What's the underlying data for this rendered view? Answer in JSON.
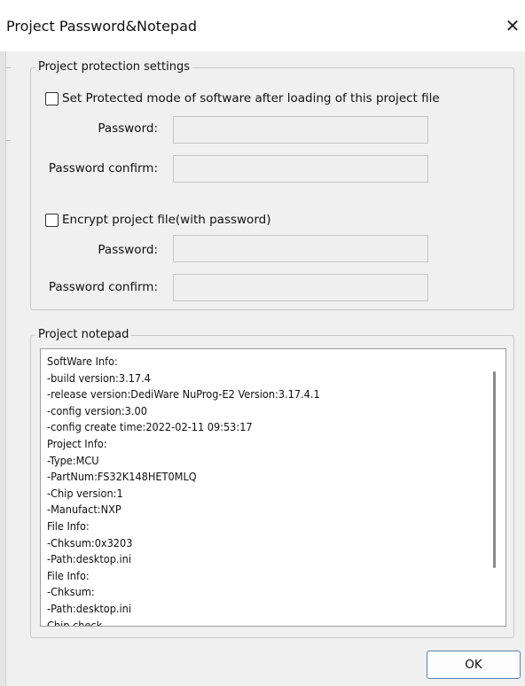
{
  "window": {
    "title": "Project Password&Notepad",
    "close_icon": "close-icon"
  },
  "protection": {
    "legend": "Project protection settings",
    "protected_mode": {
      "label": "Set Protected mode of software after loading of this project file",
      "checked": false,
      "password_label": "Password:",
      "password_value": "",
      "confirm_label": "Password confirm:",
      "confirm_value": ""
    },
    "encrypt": {
      "label": "Encrypt project file(with password)",
      "checked": false,
      "password_label": "Password:",
      "password_value": "",
      "confirm_label": "Password confirm:",
      "confirm_value": ""
    }
  },
  "notepad": {
    "legend": "Project notepad",
    "lines": [
      "SoftWare Info:",
      "-build version:3.17.4",
      "-release version:DediWare NuProg-E2 Version:3.17.4.1",
      "-config version:3.00",
      "-config create time:2022-02-11 09:53:17",
      "Project Info:",
      "-Type:MCU",
      "-PartNum:FS32K148HET0MLQ",
      "-Chip version:1",
      "-Manufact:NXP",
      "File Info:",
      "-Chksum:0x3203",
      "-Path:desktop.ini",
      "File Info:",
      "-Chksum:",
      "-Path:desktop.ini",
      "Chip check"
    ]
  },
  "footer": {
    "ok_label": "OK"
  }
}
